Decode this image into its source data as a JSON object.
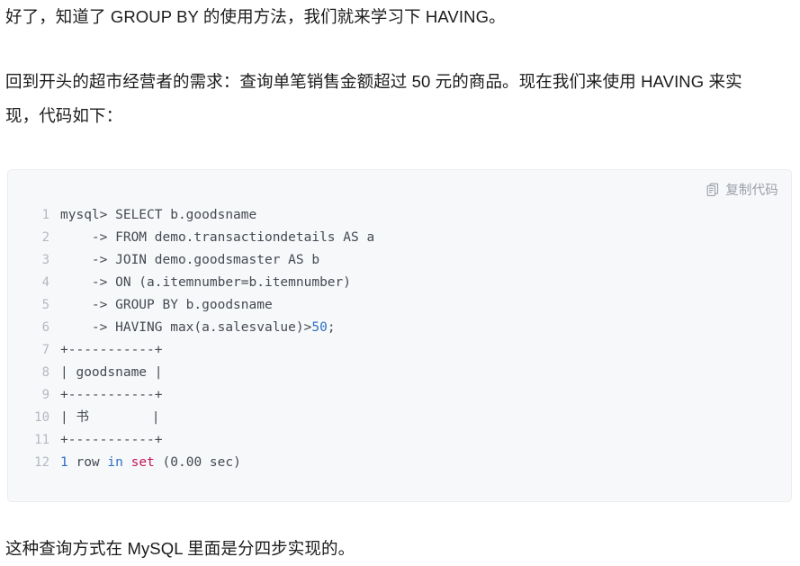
{
  "page": {
    "background": "#ffffff",
    "text_color": "#1c1c1c"
  },
  "paragraphs": {
    "intro": "好了，知道了 GROUP BY 的使用方法，我们就来学习下 HAVING。",
    "requirement": "回到开头的超市经营者的需求：查询单笔销售金额超过 50 元的商品。现在我们来使用 HAVING 来实现，代码如下：",
    "closing": "这种查询方式在 MySQL 里面是分四步实现的。"
  },
  "code_block": {
    "background": "#f7f8fa",
    "border_color": "#ececf0",
    "copy_button": {
      "label": "复制代码",
      "icon": "copy-icon",
      "color": "#9b9fa8"
    },
    "line_number_color": "#b3b8c2",
    "code_color": "#444a52",
    "accent_number_color": "#2e6fc7",
    "accent_keyword_color": "#c2185b",
    "lines": [
      {
        "number": "1",
        "segments": [
          {
            "text": "mysql> SELECT b.goodsname",
            "type": "plain"
          }
        ]
      },
      {
        "number": "2",
        "segments": [
          {
            "text": "    -> FROM demo.transactiondetails AS a",
            "type": "plain"
          }
        ]
      },
      {
        "number": "3",
        "segments": [
          {
            "text": "    -> JOIN demo.goodsmaster AS b",
            "type": "plain"
          }
        ]
      },
      {
        "number": "4",
        "segments": [
          {
            "text": "    -> ON (a.itemnumber=b.itemnumber)",
            "type": "plain"
          }
        ]
      },
      {
        "number": "5",
        "segments": [
          {
            "text": "    -> GROUP BY b.goodsname",
            "type": "plain"
          }
        ]
      },
      {
        "number": "6",
        "segments": [
          {
            "text": "    -> HAVING max(a.salesvalue)>",
            "type": "plain"
          },
          {
            "text": "50",
            "type": "num"
          },
          {
            "text": ";",
            "type": "plain"
          }
        ]
      },
      {
        "number": "7",
        "segments": [
          {
            "text": "+-----------+",
            "type": "plain"
          }
        ]
      },
      {
        "number": "8",
        "segments": [
          {
            "text": "| goodsname |",
            "type": "plain"
          }
        ]
      },
      {
        "number": "9",
        "segments": [
          {
            "text": "+-----------+",
            "type": "plain"
          }
        ]
      },
      {
        "number": "10",
        "segments": [
          {
            "text": "| 书        |",
            "type": "plain"
          }
        ]
      },
      {
        "number": "11",
        "segments": [
          {
            "text": "+-----------+",
            "type": "plain"
          }
        ]
      },
      {
        "number": "12",
        "segments": [
          {
            "text": "1",
            "type": "num"
          },
          {
            "text": " row ",
            "type": "plain"
          },
          {
            "text": "in",
            "type": "kw"
          },
          {
            "text": " ",
            "type": "plain"
          },
          {
            "text": "set",
            "type": "fn"
          },
          {
            "text": " (0.00 sec)",
            "type": "plain"
          }
        ]
      }
    ]
  }
}
